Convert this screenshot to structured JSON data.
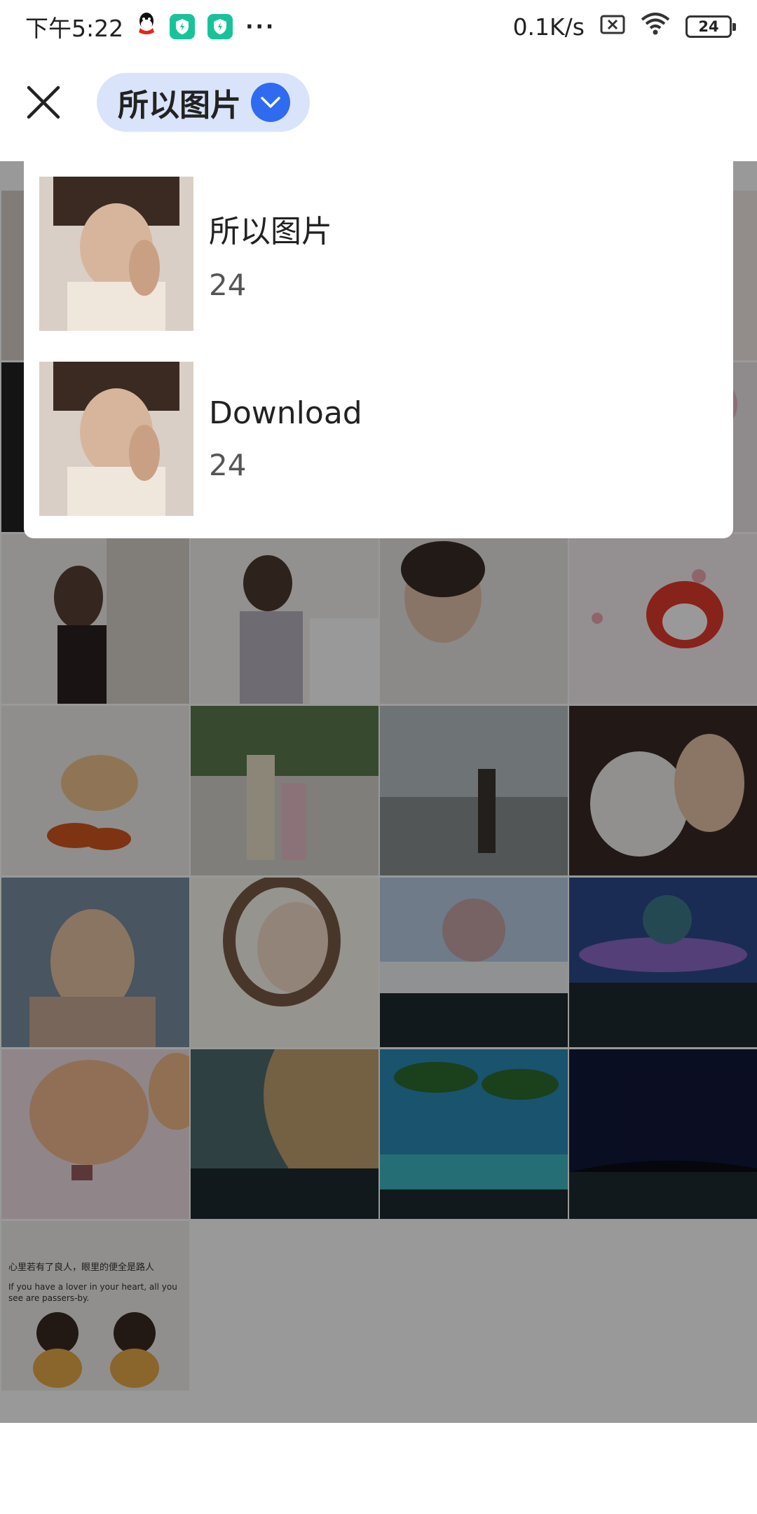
{
  "status_bar": {
    "time": "下午5:22",
    "more": "···",
    "net_speed": "0.1K/s",
    "battery": "24",
    "icons": [
      "qq-icon",
      "shield-icon",
      "shield-icon",
      "sim-off-icon",
      "wifi-icon",
      "battery-icon"
    ]
  },
  "header": {
    "close_icon": "close-icon",
    "album_selector_label": "所以图片",
    "chevron_icon": "chevron-down-icon",
    "accent_color": "#2f6bf0"
  },
  "album_dropdown": {
    "items": [
      {
        "name": "所以图片",
        "count": "24"
      },
      {
        "name": "Download",
        "count": "24"
      }
    ]
  },
  "photo_grid": {
    "total": 24,
    "captions": [
      "",
      "",
      "",
      "",
      "",
      "",
      "",
      "",
      "",
      "",
      "",
      "",
      "",
      "",
      "",
      "",
      "",
      "",
      "",
      "",
      "",
      "",
      "",
      "心里若有了良人，眼里的便全是路人"
    ],
    "caption_en": "If you have a lover in your heart, all you see are passers-by."
  }
}
